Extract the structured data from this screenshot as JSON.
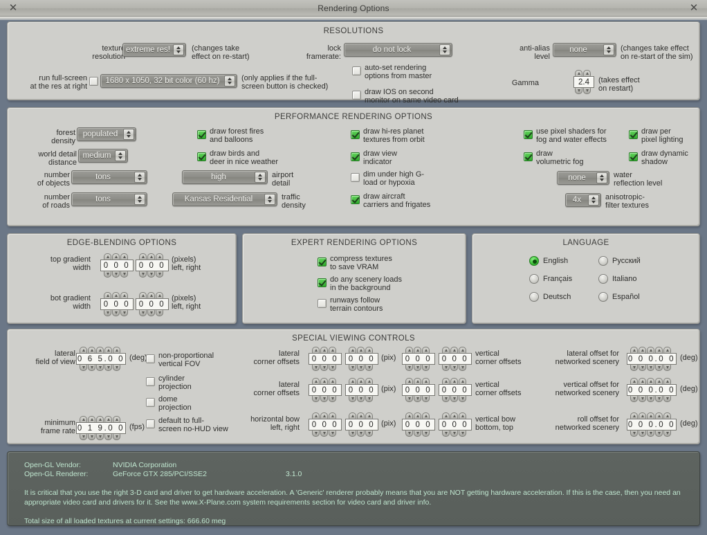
{
  "window": {
    "title": "Rendering Options",
    "close_icon": "close-icon",
    "close_glyph": "✕"
  },
  "resolutions": {
    "title": "RESOLUTIONS",
    "texture_resolution_label": "texture\nresolution",
    "texture_resolution_value": "extreme res!",
    "texture_resolution_note": "(changes take\neffect on re-start)",
    "fullscreen_label": "run full-screen\nat the res at right",
    "fullscreen_checked": false,
    "resolution_value": "1680 x 1050, 32 bit color (60 hz)",
    "resolution_note": "(only applies if the full-\nscreen button is checked)",
    "lock_framerate_label": "lock\nframerate:",
    "lock_framerate_value": "do not lock",
    "autoset_label": "auto-set rendering\noptions from master",
    "autoset_checked": false,
    "draw_ios_label": "draw IOS on second\nmonitor on same video card",
    "draw_ios_checked": false,
    "antialias_label": "anti-alias\nlevel",
    "antialias_value": "none",
    "antialias_note": "(changes take effect\non re-start of the sim)",
    "gamma_label": "Gamma",
    "gamma_value": "2.4",
    "gamma_note": "(takes effect\non restart)"
  },
  "performance": {
    "title": "PERFORMANCE RENDERING OPTIONS",
    "forest_density_label": "forest\ndensity",
    "forest_density_value": "populated",
    "world_detail_label": "world detail\ndistance",
    "world_detail_value": "medium",
    "number_objects_label": "number\nof objects",
    "number_objects_value": "tons",
    "number_roads_label": "number\nof roads",
    "number_roads_value": "tons",
    "draw_forest_fires_label": "draw forest fires\nand balloons",
    "draw_forest_fires_checked": true,
    "draw_birds_label": "draw birds and\ndeer in nice weather",
    "draw_birds_checked": true,
    "airport_detail_value": "high",
    "airport_detail_label": "airport\ndetail",
    "traffic_density_value": "Kansas Residential",
    "traffic_density_label": "traffic\ndensity",
    "draw_hires_label": "draw hi-res planet\ntextures from orbit",
    "draw_hires_checked": true,
    "draw_view_indicator_label": "draw view\nindicator",
    "draw_view_indicator_checked": true,
    "dim_under_g_label": "dim under high G-\nload or hypoxia",
    "dim_under_g_checked": false,
    "draw_carriers_label": "draw aircraft\ncarriers and frigates",
    "draw_carriers_checked": true,
    "pixel_shaders_label": "use pixel shaders for\nfog and water effects",
    "pixel_shaders_checked": true,
    "volumetric_fog_label": "draw\nvolumetric fog",
    "volumetric_fog_checked": true,
    "water_reflection_value": "none",
    "water_reflection_label": "water\nreflection level",
    "anisotropic_value": "4x",
    "anisotropic_label": "anisotropic-\nfilter textures",
    "per_pixel_lighting_label": "draw per\npixel lighting",
    "per_pixel_lighting_checked": true,
    "dynamic_shadow_label": "draw dynamic\nshadow",
    "dynamic_shadow_checked": true
  },
  "edge_blending": {
    "title": "EDGE-BLENDING OPTIONS",
    "top_gradient_label": "top gradient\nwidth",
    "top_left_value": "0 0 0",
    "top_right_value": "0 0 0",
    "top_units": "(pixels)\nleft, right",
    "bot_gradient_label": "bot gradient\nwidth",
    "bot_left_value": "0 0 0",
    "bot_right_value": "0 0 0",
    "bot_units": "(pixels)\nleft, right"
  },
  "expert": {
    "title": "EXPERT RENDERING OPTIONS",
    "compress_label": "compress textures\nto save VRAM",
    "compress_checked": true,
    "scenery_loads_label": "do any scenery loads\nin the background",
    "scenery_loads_checked": true,
    "runways_label": "runways follow\nterrain contours",
    "runways_checked": false
  },
  "language": {
    "title": "LANGUAGE",
    "options": [
      {
        "label": "English",
        "selected": true
      },
      {
        "label": "Français",
        "selected": false
      },
      {
        "label": "Deutsch",
        "selected": false
      },
      {
        "label": "Русский",
        "selected": false
      },
      {
        "label": "Italiano",
        "selected": false
      },
      {
        "label": "Español",
        "selected": false
      }
    ]
  },
  "viewing": {
    "title": "SPECIAL VIEWING CONTROLS",
    "fov_label": "lateral\nfield of view",
    "fov_value": "0 6 5.0 0",
    "fov_units": "(deg)",
    "min_frame_label": "minimum\nframe rate",
    "min_frame_value": "0 1 9.0 0",
    "min_frame_units": "(fps)",
    "nonprop_label": "non-proportional\nvertical FOV",
    "nonprop_checked": false,
    "cylinder_label": "cylinder\nprojection",
    "cylinder_checked": false,
    "dome_label": "dome\nprojection",
    "dome_checked": false,
    "nohud_label": "default to full-\nscreen no-HUD view",
    "nohud_checked": false,
    "lat_corner_1_label": "lateral\ncorner offsets",
    "lat_corner_1_a": "0 0 0",
    "lat_corner_1_b": "0 0 0",
    "lat_corner_1_units": "(pix)",
    "lat_corner_2_label": "lateral\ncorner offsets",
    "lat_corner_2_a": "0 0 0",
    "lat_corner_2_b": "0 0 0",
    "lat_corner_2_units": "(pix)",
    "hbow_label": "horizontal bow\nleft, right",
    "hbow_a": "0 0 0",
    "hbow_b": "0 0 0",
    "hbow_units": "(pix)",
    "vert_corner_1_a": "0 0 0",
    "vert_corner_1_b": "0 0 0",
    "vert_corner_1_label": "vertical\ncorner offsets",
    "vert_corner_2_a": "0 0 0",
    "vert_corner_2_b": "0 0 0",
    "vert_corner_2_label": "vertical\ncorner offsets",
    "vbow_a": "0 0 0",
    "vbow_b": "0 0 0",
    "vbow_label": "vertical bow\nbottom, top",
    "lat_offset_label": "lateral offset for\nnetworked scenery",
    "lat_offset_value": "0 0 0.0 0",
    "lat_offset_units": "(deg)",
    "vert_offset_label": "vertical offset for\nnetworked scenery",
    "vert_offset_value": "0 0 0.0 0",
    "vert_offset_units": "(deg)",
    "roll_offset_label": "roll offset for\nnetworked scenery",
    "roll_offset_value": "0 0 0.0 0",
    "roll_offset_units": "(deg)"
  },
  "status": {
    "vendor_label": "Open-GL Vendor:",
    "vendor_value": "NVIDIA Corporation",
    "renderer_label": "Open-GL Renderer:",
    "renderer_value": "GeForce GTX 285/PCI/SSE2",
    "renderer_version": "3.1.0",
    "warning": "It is critical that you use the right 3-D card and driver to get hardware acceleration. A 'Generic' renderer probably means that you are NOT getting hardware acceleration. If this is the case, then you need an appropriate video card and drivers for it. See the www.X-Plane.com system requirements section for video card and driver info.",
    "textures": "Total size of all loaded textures at current settings: 666.60 meg"
  }
}
